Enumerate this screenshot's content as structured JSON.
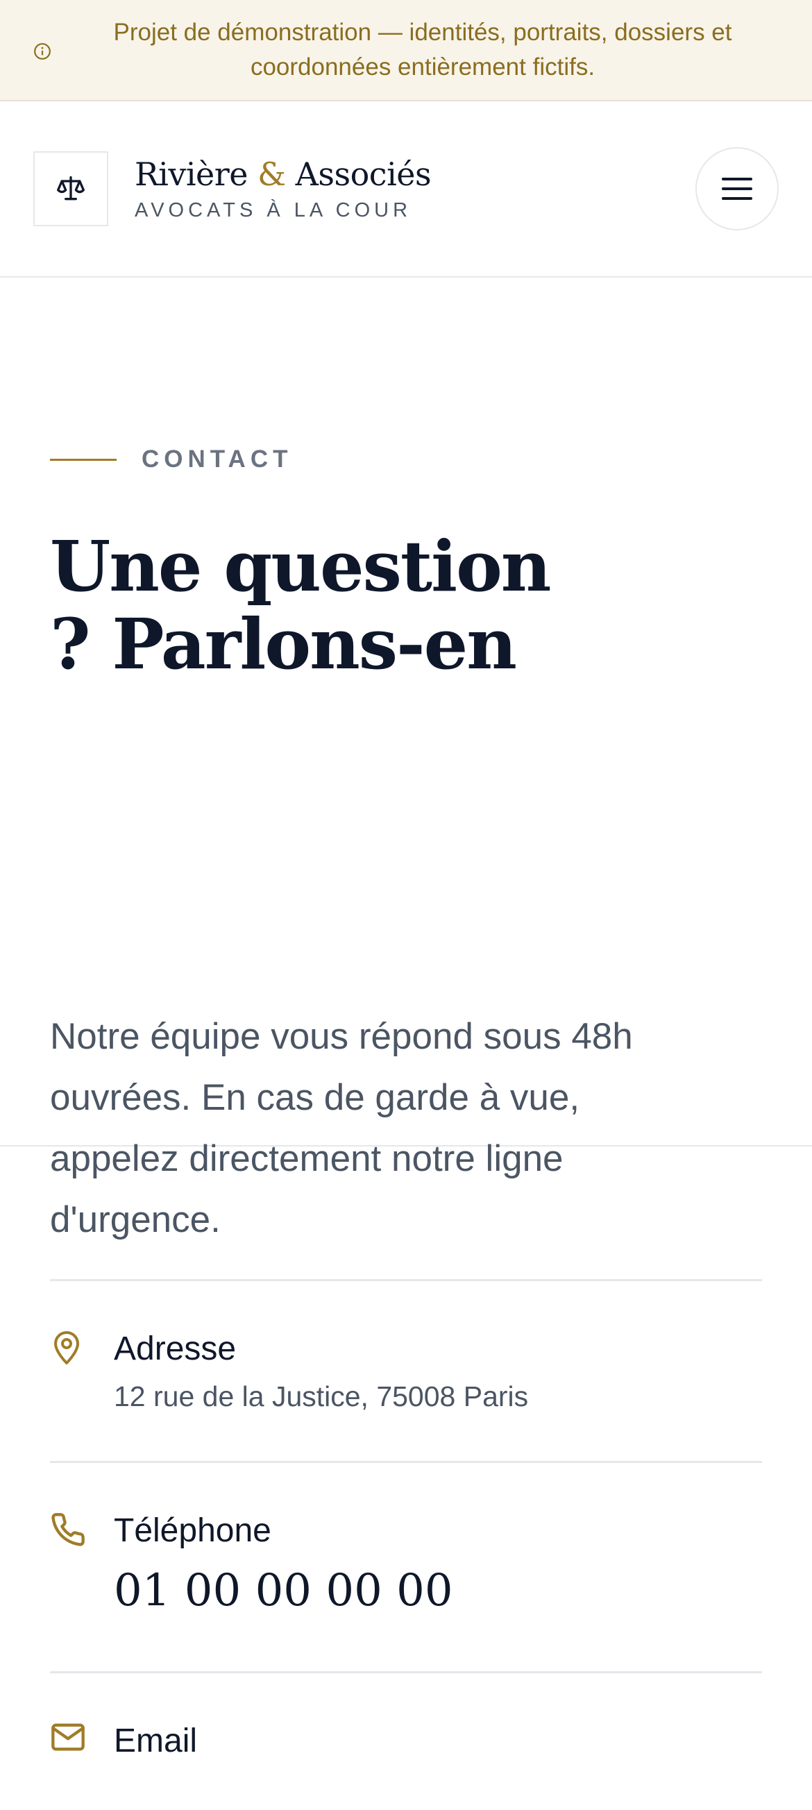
{
  "banner": {
    "text": "Projet de démonstration — identités, portraits, dossiers et coordonnées entièrement fictifs.",
    "icon": "info-icon"
  },
  "header": {
    "brand_part1": "Rivière ",
    "brand_amp": "&",
    "brand_part2": " Associés",
    "brand_subtitle": "AVOCATS À LA COUR",
    "logo_icon": "scales-icon",
    "menu_icon": "hamburger-icon"
  },
  "hero": {
    "eyebrow": "CONTACT",
    "title": "Une question ? Parlons-en",
    "lead": "Notre équipe vous répond sous 48h ouvrées. En cas de garde à vue, appelez directement notre ligne d'urgence."
  },
  "contact": {
    "address_label": "Adresse",
    "address_value": "12 rue de la Justice, 75008 Paris",
    "phone_label": "Téléphone",
    "phone_value": "01 00 00 00 00",
    "email_label": "Email"
  },
  "colors": {
    "accent": "#a07c28",
    "banner_bg": "#f8f4ea",
    "text_dark": "#0f172a",
    "text_muted": "#4b5563"
  }
}
